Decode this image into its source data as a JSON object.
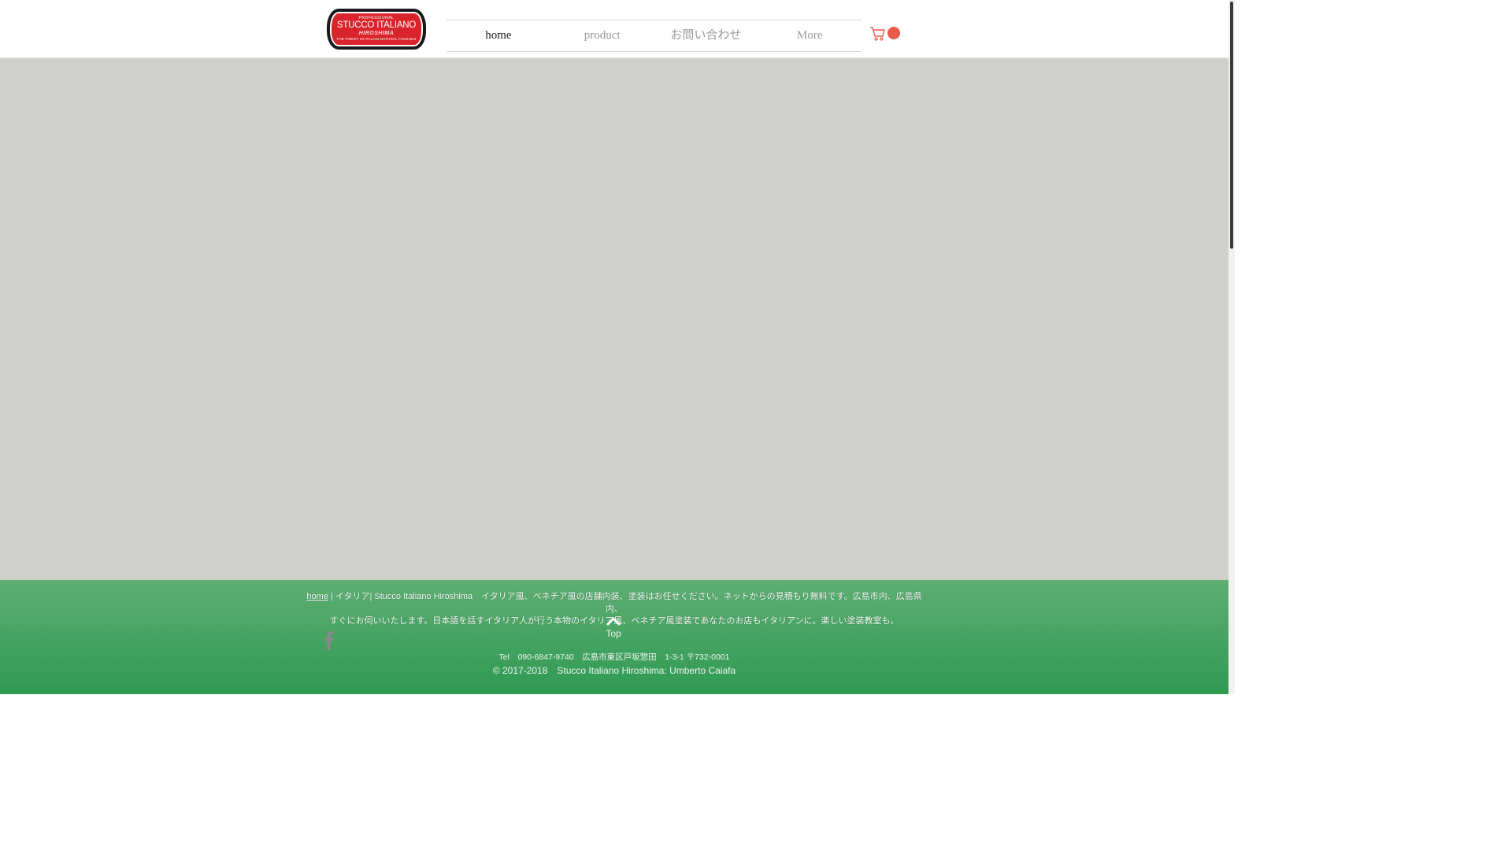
{
  "logo": {
    "line1": "PROFESSIONAL",
    "line2": "STUCCO ITALIANO",
    "line3": "HIROSHIMA",
    "line4": "THE FINEST IN ITALIAN NATURAL FINISHES"
  },
  "nav": {
    "items": [
      {
        "label": "home",
        "active": true
      },
      {
        "label": "product",
        "active": false
      },
      {
        "label": "お問い合わせ",
        "active": false
      },
      {
        "label": "More",
        "active": false
      }
    ]
  },
  "cart": {
    "icon": "cart-icon",
    "accent": "#e85a4a"
  },
  "footer": {
    "desc_link": "home",
    "desc_rest_1": " | イタリア| Stucco Italiano Hiroshima　イタリア風、ベネチア風の店舗内装、塗装はお任せください。ネットからの見積もり無料です。広島市内、広島県内、",
    "desc_rest_2": "すぐにお伺いいたします。日本語を話すイタリア人が行う本物のイタリア風、ベネチア風塗装であなたのお店もイタリアンに。楽しい塗装教室も。",
    "top_label": "Top",
    "contact": "Tel　090-6847-9740　広島市東区戸坂惣田　1-3-1 〒732-0001",
    "copyright": "© 2017-2018　Stucco Italiano Hiroshima: Umberto Caiafa"
  },
  "colors": {
    "main_bg": "#cfcfcb",
    "footer_top": "#5fae73",
    "footer_bottom": "#2e9a52"
  }
}
